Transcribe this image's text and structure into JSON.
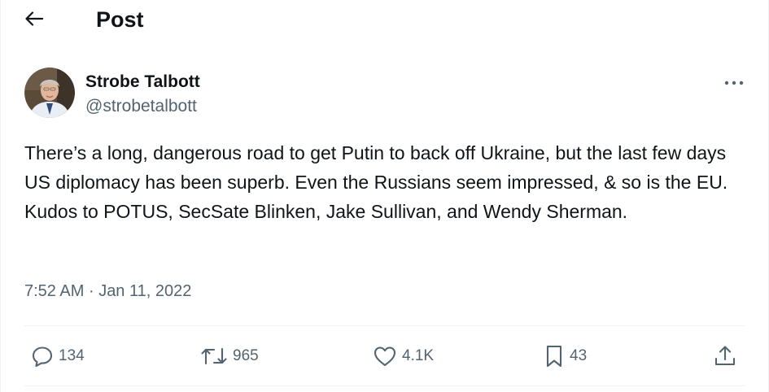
{
  "header": {
    "title": "Post"
  },
  "author": {
    "display_name": "Strobe Talbott",
    "handle": "@strobetalbott"
  },
  "post": {
    "text": "There’s a long, dangerous road to get Putin to back off Ukraine, but the last few days US diplomacy has been superb. Even the Russians seem impressed, & so is the EU. Kudos to POTUS, SecSate Blinken, Jake Sullivan, and Wendy Sherman.",
    "time": "7:52 AM",
    "separator": "·",
    "date": "Jan 11, 2022"
  },
  "actions": {
    "replies": "134",
    "reposts": "965",
    "likes": "4.1K",
    "bookmarks": "43"
  },
  "icons": {
    "back": "arrow-left-icon",
    "more": "more-horizontal-icon",
    "reply": "reply-icon",
    "repost": "repost-icon",
    "like": "heart-icon",
    "bookmark": "bookmark-icon",
    "share": "share-icon"
  },
  "colors": {
    "text": "#0f1419",
    "secondary": "#536471",
    "divider": "#eff3f4"
  }
}
